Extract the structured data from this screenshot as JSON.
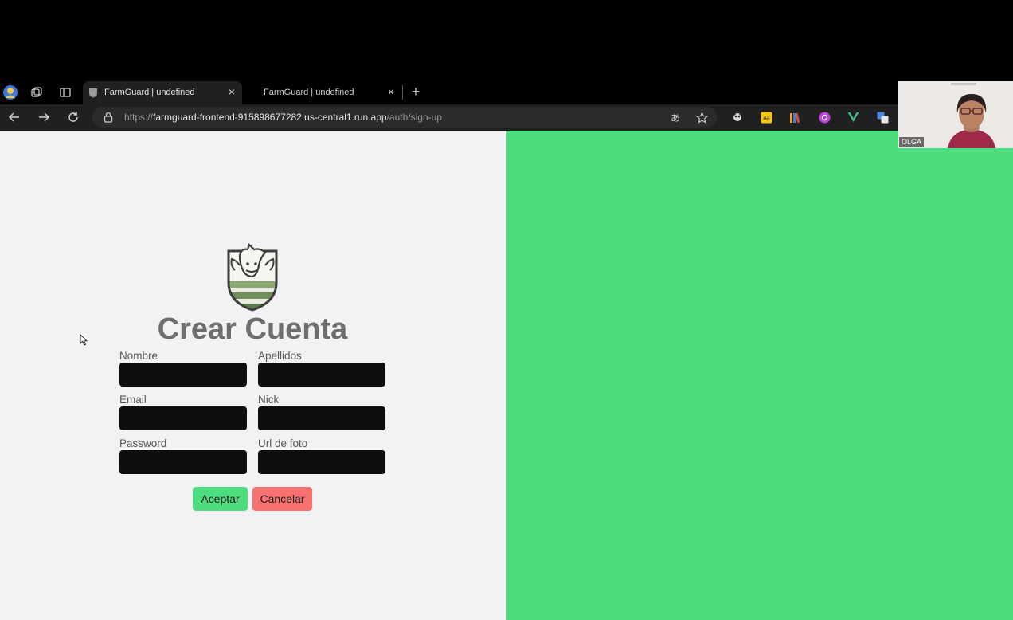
{
  "browser": {
    "tabs": [
      {
        "title": "FarmGuard | undefined",
        "active": true
      },
      {
        "title": "FarmGuard | undefined",
        "active": false
      }
    ],
    "url": {
      "prefix": "https://",
      "host": "farmguard-frontend-915898677282.us-central1.run.app",
      "path": "/auth/sign-up"
    }
  },
  "form": {
    "title": "Crear Cuenta",
    "fields": {
      "nombre": "Nombre",
      "apellidos": "Apellidos",
      "email": "Email",
      "nick": "Nick",
      "password": "Password",
      "url_foto": "Url de foto"
    },
    "accept_label": "Aceptar",
    "cancel_label": "Cancelar"
  },
  "webcam": {
    "name": "OLGA"
  },
  "colors": {
    "accent_green": "#4ddd7e",
    "cancel_red": "#f87171",
    "form_bg": "#f2f2f2",
    "title_gray": "#6e6e6e"
  }
}
